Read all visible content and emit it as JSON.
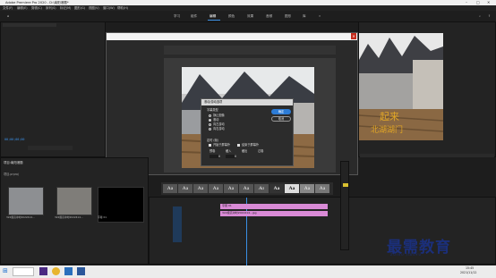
{
  "window": {
    "title": "Adobe Premiere Pro 2020 - D:\\南阳港题*"
  },
  "menu": [
    "文件(F)",
    "编辑(E)",
    "剪辑(C)",
    "序列(S)",
    "标记(M)",
    "图形(G)",
    "视图(V)",
    "窗口(W)",
    "帮助(H)"
  ],
  "workspaces": [
    "学习",
    "组件",
    "编辑",
    "颜色",
    "效果",
    "音频",
    "图形",
    "库"
  ],
  "workspace_active": "编辑",
  "source": {
    "timecode_left": "00;00;00;00"
  },
  "project": {
    "title": "项目:南阳港题",
    "file": "项目.prproj",
    "items": [
      {
        "label": "322级高冲时2022414..."
      },
      {
        "label": "322级高冲时2022414..."
      },
      {
        "label": "字幕 01"
      }
    ]
  },
  "program": {
    "timecode": "00;00;00;00",
    "caption_line1": "起来",
    "caption_line2": "北湖湖门"
  },
  "dialog": {
    "title": "滚动/游动选项",
    "section_type": "字幕类型",
    "options": [
      "静止图像",
      "滚动",
      "向左游动",
      "向右游动"
    ],
    "selected": "滚动",
    "section_timing": "定时 (帧)",
    "check_start": "开始于屏幕外",
    "check_end": "结束于屏幕外",
    "fields": [
      "预卷",
      "缓入",
      "缓出",
      "过卷"
    ],
    "values": [
      "0",
      "0",
      "",
      ""
    ],
    "ok": "确定",
    "cancel": "取消"
  },
  "styles": [
    "Aa",
    "Aa",
    "Aa",
    "Aa",
    "Aa",
    "Aa",
    "Aa",
    "Aa",
    "Aa",
    "Aa",
    "Aa"
  ],
  "timeline": {
    "clip1": "字幕 01",
    "clip2": "322级高冲时2022414...jpg"
  },
  "watermark": {
    "main": "最需教育",
    "sub": "ZUIXU JIAOYU"
  },
  "taskbar": {
    "time": "15:45",
    "date": "2021/11/12"
  }
}
